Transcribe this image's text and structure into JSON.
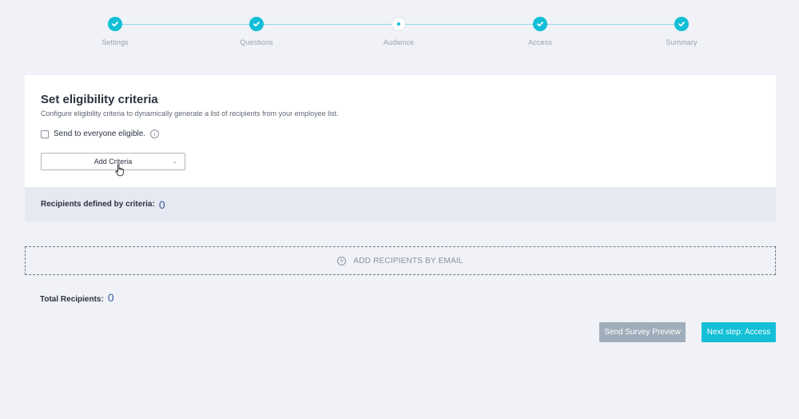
{
  "stepper": {
    "steps": [
      {
        "label": "Settings",
        "state": "done"
      },
      {
        "label": "Questions",
        "state": "done"
      },
      {
        "label": "Audience",
        "state": "current"
      },
      {
        "label": "Access",
        "state": "done"
      },
      {
        "label": "Summary",
        "state": "done"
      }
    ]
  },
  "criteria_card": {
    "title": "Set eligibility criteria",
    "description": "Configure eligibility criteria to dynamically generate a list of recipients from your employee list.",
    "send_everyone_label": "Send to everyone eligible.",
    "send_everyone_checked": false,
    "info_icon": "i",
    "add_criteria_label": "Add Criteria",
    "add_criteria_chevron": "⌄",
    "recipients_label": "Recipients defined by criteria:",
    "recipients_count": "0"
  },
  "add_email": {
    "icon": "+",
    "label": "ADD RECIPIENTS BY EMAIL"
  },
  "total": {
    "label": "Total Recipients:",
    "count": "0"
  },
  "actions": {
    "preview_label": "Send Survey Preview",
    "next_label": "Next step: Access"
  },
  "colors": {
    "accent": "#12bfd6",
    "count_blue": "#3a5a9c",
    "preview_button": "#a0adbb",
    "background": "#f0f2f7"
  }
}
